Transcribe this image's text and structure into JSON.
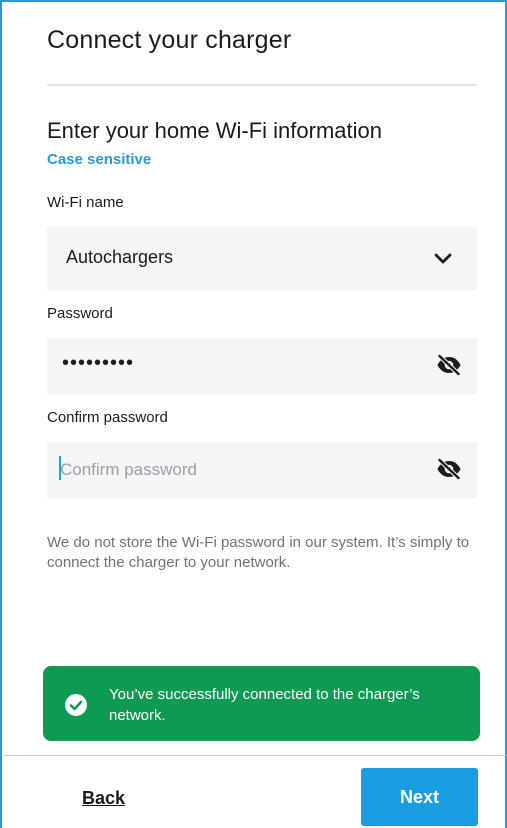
{
  "header": {
    "title": "Connect your charger"
  },
  "form": {
    "heading": "Enter your home Wi-Fi information",
    "case_note": "Case sensitive",
    "wifi": {
      "label": "Wi-Fi name",
      "value": "Autochargers",
      "icon": "chevron-down-icon"
    },
    "password": {
      "label": "Password",
      "masked_value": "•••••••••",
      "icon": "eye-slash-icon"
    },
    "confirm": {
      "label": "Confirm password",
      "value": "",
      "placeholder": "Confirm password",
      "icon": "eye-slash-icon"
    },
    "privacy_note": "We do not store the Wi-Fi password in our system. It’s simply to connect the charger to your network."
  },
  "toast": {
    "message": "You’ve successfully connected to the charger’s network.",
    "icon": "check-circle-icon",
    "color": "#0f9a54"
  },
  "footer": {
    "back_label": "Back",
    "next_label": "Next"
  },
  "colors": {
    "accent": "#1a9ce0",
    "field_bg": "#f4f5f7",
    "success": "#0f9a54"
  }
}
